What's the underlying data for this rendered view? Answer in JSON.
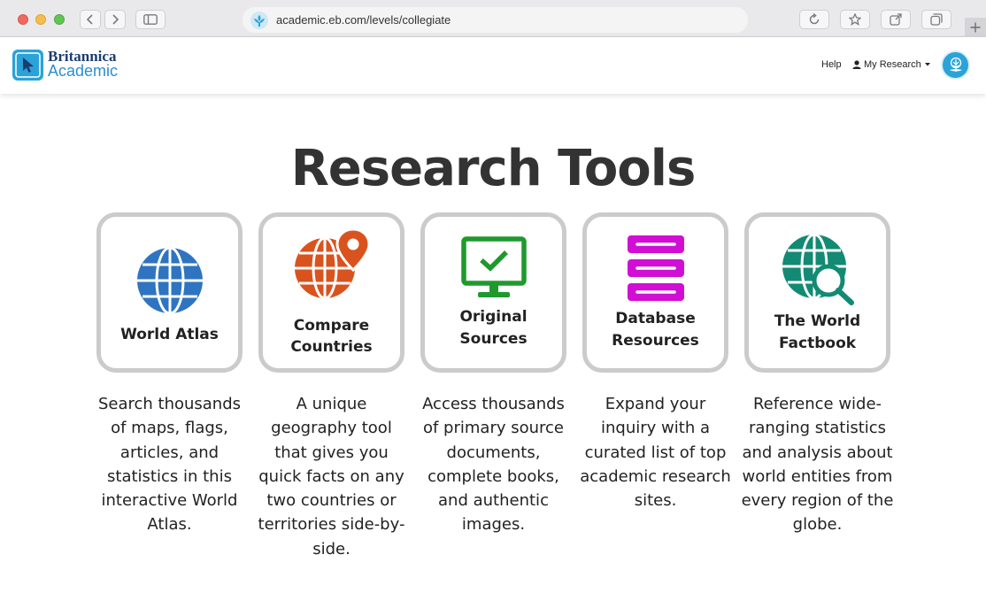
{
  "browser": {
    "url": "academic.eb.com/levels/collegiate"
  },
  "header": {
    "logo_line1": "Britannica",
    "logo_line2": "Academic",
    "help": "Help",
    "my_research": "My Research"
  },
  "main": {
    "title": "Research Tools",
    "cards": [
      {
        "label_l1": "World Atlas",
        "label_l2": "",
        "color": "#2f74c0",
        "desc": [
          "Search thousands",
          "of maps, flags,",
          "articles, and",
          "statistics in this",
          "interactive World",
          "Atlas."
        ]
      },
      {
        "label_l1": "Compare",
        "label_l2": "Countries",
        "color": "#d9531e",
        "desc": [
          "A unique",
          "geography tool",
          "that gives you",
          "quick facts on any",
          "two countries or",
          "territories side-by-",
          "side."
        ]
      },
      {
        "label_l1": "Original",
        "label_l2": "Sources",
        "color": "#1e9a2c",
        "desc": [
          "Access thousands",
          "of primary source",
          "documents,",
          "complete books,",
          "and authentic",
          "images."
        ]
      },
      {
        "label_l1": "Database",
        "label_l2": "Resources",
        "color": "#d10fd4",
        "desc": [
          "Expand your",
          "inquiry with a",
          "curated list of top",
          "academic research",
          "sites."
        ]
      },
      {
        "label_l1": "The World",
        "label_l2": "Factbook",
        "color": "#138a73",
        "desc": [
          "Reference wide-",
          "ranging statistics",
          "and analysis about",
          "world entities from",
          "every region of the",
          "globe."
        ]
      }
    ]
  }
}
